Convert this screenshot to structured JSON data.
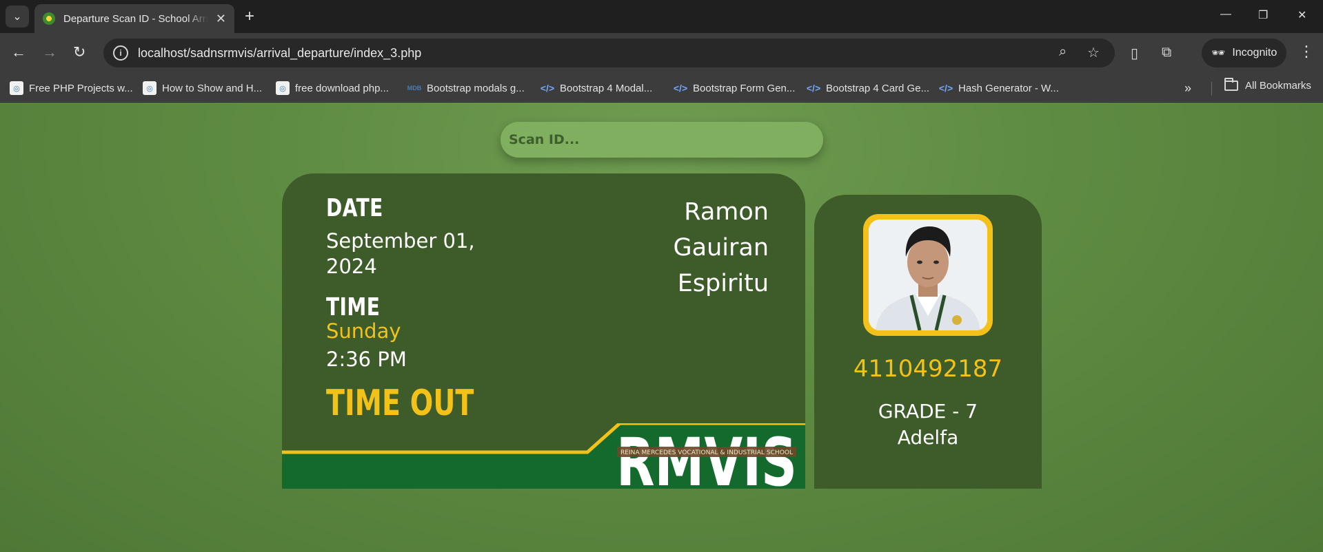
{
  "browser": {
    "tab_title": "Departure Scan ID - School Arrival",
    "tab_close": "✕",
    "new_tab": "+",
    "url": "localhost/sadnsrmvis/arrival_departure/index_3.php",
    "incognito_label": "Incognito",
    "bookmarks": [
      {
        "label": "Free PHP Projects w...",
        "icon": "php"
      },
      {
        "label": "How to Show and H...",
        "icon": "php"
      },
      {
        "label": "free download php...",
        "icon": "php"
      },
      {
        "label": "Bootstrap modals g...",
        "icon": "mdb"
      },
      {
        "label": "Bootstrap 4 Modal...",
        "icon": "code"
      },
      {
        "label": "Bootstrap Form Gen...",
        "icon": "code"
      },
      {
        "label": "Bootstrap 4 Card Ge...",
        "icon": "code"
      },
      {
        "label": "Hash Generator - W...",
        "icon": "code"
      }
    ],
    "all_bookmarks": "All Bookmarks"
  },
  "scan": {
    "placeholder": "Scan ID..."
  },
  "record": {
    "date_label": "DATE",
    "date_value": "September 01, 2024",
    "time_label": "TIME",
    "day": "Sunday",
    "time_value": "2:36 PM",
    "status": "TIME OUT",
    "name": {
      "first": "Ramon",
      "middle": "Gauiran",
      "last": "Espiritu"
    }
  },
  "school": {
    "logo_text": "RMVIS",
    "full_name": "REINA MERCEDES VOCATIONAL & INDUSTRIAL SCHOOL"
  },
  "student": {
    "id": "4110492187",
    "grade": "GRADE - 7",
    "section": "Adelfa"
  },
  "colors": {
    "card": "#3e5b2a",
    "accent": "#f2c218",
    "footer_green": "#136a2c"
  }
}
